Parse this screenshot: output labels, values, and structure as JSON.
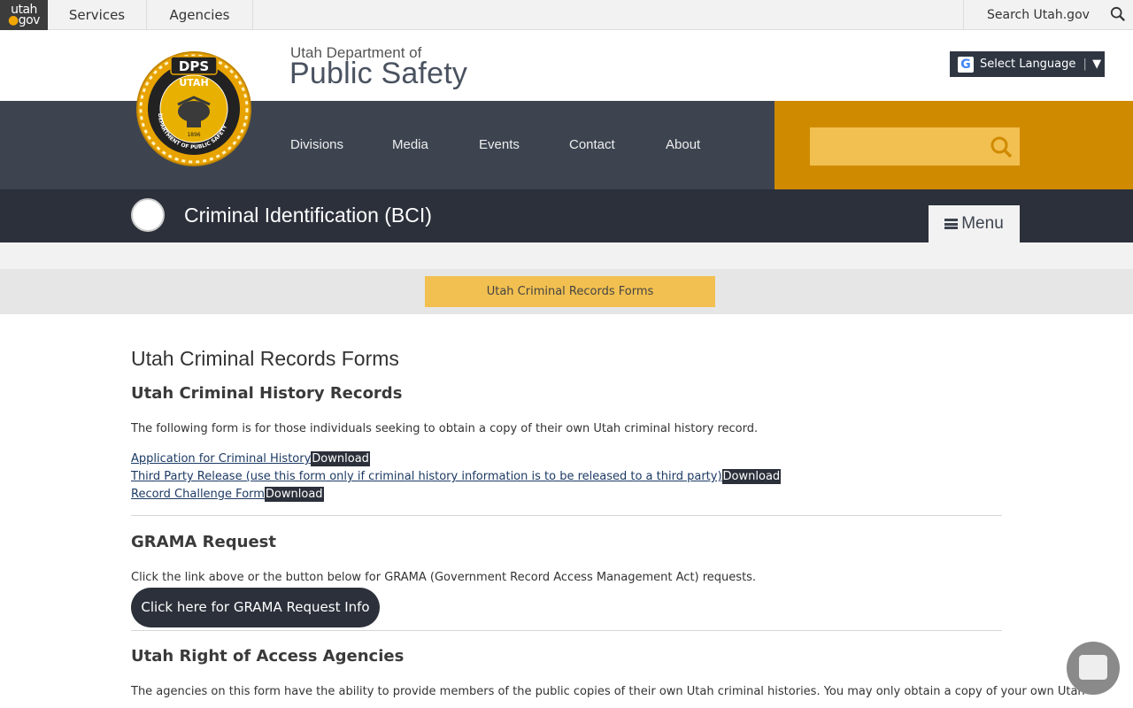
{
  "topbar": {
    "logo_top": "utah",
    "logo_bottom": "gov",
    "services": "Services",
    "agencies": "Agencies",
    "search_label": "Search Utah.gov"
  },
  "header": {
    "dept_small": "Utah Department of",
    "dept_big": "Public Safety",
    "language_button": "Select Language",
    "language_arrow": "▼",
    "seal_text_top": "DPS",
    "seal_text_mid": "UTAH",
    "seal_text_ring": "DEPARTMENT OF PUBLIC SAFETY",
    "seal_year": "1896",
    "nav": [
      "Divisions",
      "Media",
      "Events",
      "Contact",
      "About"
    ],
    "site_search_placeholder": ""
  },
  "section": {
    "title": "Criminal Identification (BCI)",
    "menu_label": "Menu"
  },
  "breadcrumb": {
    "current": "Utah Criminal Records Forms"
  },
  "content": {
    "page_title": "Utah Criminal Records Forms",
    "history": {
      "heading": "Utah Criminal History Records",
      "intro": "The following form is for those individuals seeking to obtain a copy of their own Utah criminal history record.",
      "links": [
        {
          "label": "Application for Criminal History",
          "download": "Download"
        },
        {
          "label": "Third Party Release (use this form only if criminal history information is to be released to a third party)",
          "download": "Download"
        },
        {
          "label": "Record Challenge Form",
          "download": "Download"
        }
      ]
    },
    "grama": {
      "heading": "GRAMA Request",
      "intro": "Click the link above or the button below for GRAMA (Government Record Access Management Act) requests.",
      "button": "Click here for GRAMA Request Info"
    },
    "access": {
      "heading": "Utah Right of Access Agencies",
      "intro": "The agencies on this form have the ability to provide members of the public copies of their own Utah criminal histories.  You may only obtain a copy of your own Utah"
    }
  },
  "colors": {
    "nav_dark": "#3d4450",
    "nav_orange": "#d08a00",
    "accent_yellow": "#f2c050",
    "section_dark": "#2b303a"
  }
}
